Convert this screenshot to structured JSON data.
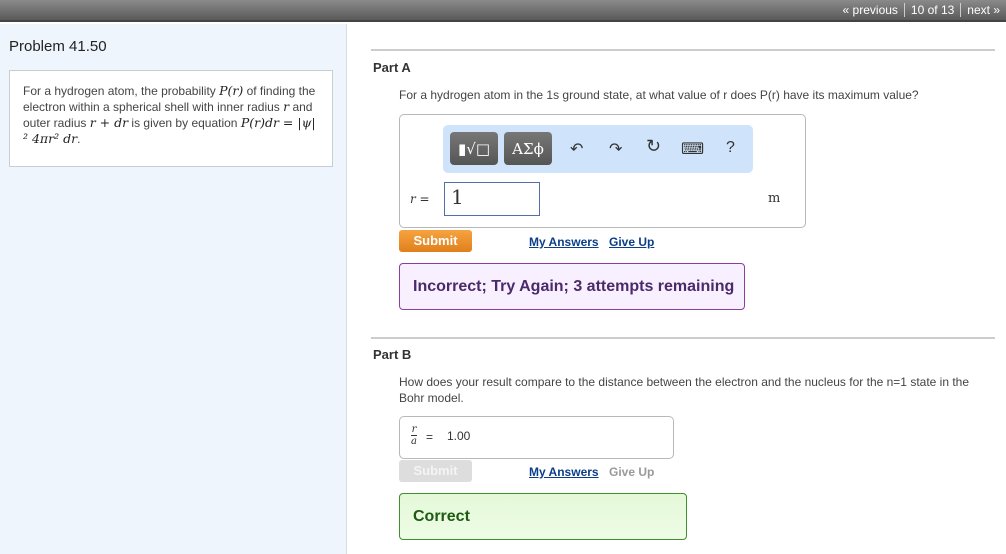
{
  "nav": {
    "previous": "« previous",
    "position": "10 of 13",
    "next": "next »"
  },
  "problem": {
    "title": "Problem 41.50",
    "text_pre": "For a hydrogen atom, the probability ",
    "pr": "P(r)",
    "text_mid1": " of finding the electron within a spherical shell with inner radius ",
    "r": "r",
    "text_mid2": " and outer radius ",
    "rdr": "r + dr",
    "text_mid3": " is given by equation ",
    "eq": "P(r)dr = |ψ|² 4πr² dr",
    "end": "."
  },
  "partA": {
    "label": "Part A",
    "question": "For a hydrogen atom in the 1s ground state, at what value of r does P(r) have its maximum value?",
    "toolbar": {
      "template": "▮√□",
      "symbols": "ΑΣϕ",
      "undo": "↶",
      "redo": "↷",
      "reset": "↻",
      "keyboard": "⌨",
      "help": "?"
    },
    "var_label": "r =",
    "value": "1",
    "unit": "m",
    "submit": "Submit",
    "my_answers": "My Answers",
    "give_up": "Give Up",
    "feedback": "Incorrect; Try Again; 3 attempts remaining"
  },
  "partB": {
    "label": "Part B",
    "question": "How does your result compare to the distance between the electron and the nucleus for the n=1 state in the Bohr model.",
    "frac_num": "r",
    "frac_den": "a",
    "eq": "=",
    "value": "1.00",
    "submit": "Submit",
    "my_answers": "My Answers",
    "give_up": "Give Up",
    "feedback": "Correct"
  }
}
